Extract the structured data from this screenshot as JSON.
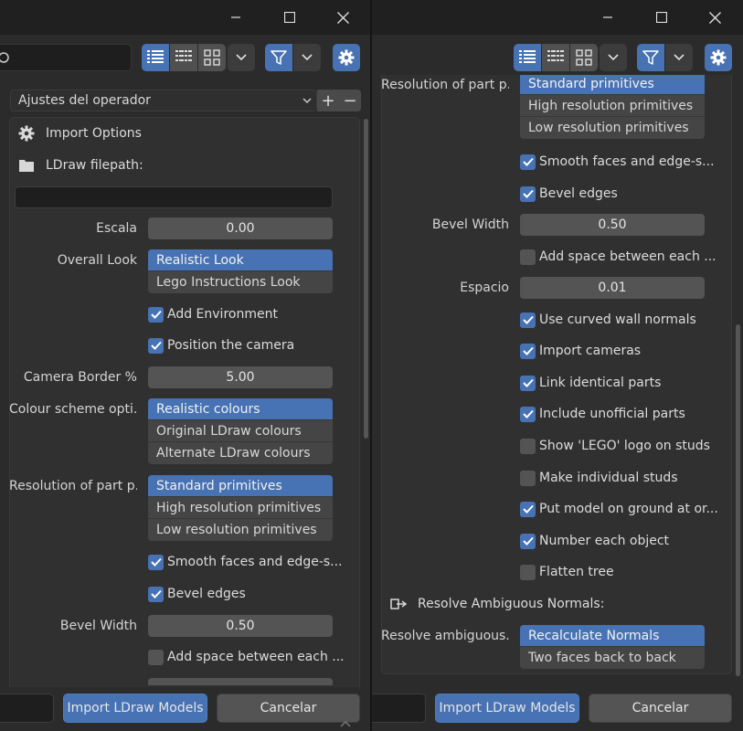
{
  "preset": {
    "label": "Ajustes del operador",
    "add_symbol": "+",
    "remove_symbol": "−"
  },
  "import_options_label": "Import Options",
  "ldraw_filepath_label": "LDraw filepath:",
  "ldraw_filepath_value": "",
  "escala": {
    "label": "Escala",
    "value": "0.00"
  },
  "overall_look": {
    "label": "Overall Look",
    "options": [
      "Realistic Look",
      "Lego Instructions Look"
    ],
    "selected": 0
  },
  "add_environment": {
    "label": "Add Environment",
    "checked": true
  },
  "position_camera": {
    "label": "Position the camera",
    "checked": true
  },
  "camera_border": {
    "label": "Camera Border %",
    "value": "5.00"
  },
  "colour_scheme": {
    "label": "Colour scheme opti...",
    "options": [
      "Realistic colours",
      "Original LDraw colours",
      "Alternate LDraw colours"
    ],
    "selected": 0
  },
  "resolution": {
    "label": "Resolution of part p...",
    "options": [
      "Standard primitives",
      "High resolution primitives",
      "Low resolution primitives"
    ],
    "selected": 0
  },
  "smooth_faces": {
    "label": "Smooth faces and edge-s...",
    "checked": true
  },
  "bevel_edges": {
    "label": "Bevel edges",
    "checked": true
  },
  "bevel_width": {
    "label": "Bevel Width",
    "value": "0.50"
  },
  "add_space": {
    "label": "Add space between each ...",
    "checked": false
  },
  "espacio": {
    "label": "Espacio",
    "value": "0.01"
  },
  "use_curved": {
    "label": "Use curved wall normals",
    "checked": true
  },
  "import_cameras": {
    "label": "Import cameras",
    "checked": true
  },
  "link_identical": {
    "label": "Link identical parts",
    "checked": true
  },
  "include_unofficial": {
    "label": "Include unofficial parts",
    "checked": true
  },
  "show_lego_logo": {
    "label": "Show 'LEGO' logo on studs",
    "checked": false
  },
  "make_individual_studs": {
    "label": "Make individual studs",
    "checked": false
  },
  "put_on_ground": {
    "label": "Put model on ground at or...",
    "checked": true
  },
  "number_each": {
    "label": "Number each object",
    "checked": true
  },
  "flatten_tree": {
    "label": "Flatten tree",
    "checked": false
  },
  "resolve_header": "Resolve Ambiguous Normals:",
  "resolve": {
    "label": "Resolve ambiguous...",
    "options": [
      "Recalculate Normals",
      "Two faces back to back"
    ],
    "selected": 0
  },
  "footer": {
    "import_label": "Import LDraw Models",
    "cancel_label": "Cancelar"
  },
  "colors": {
    "accent": "#4772b3",
    "panel": "#303030",
    "background": "#2b2b2b"
  }
}
